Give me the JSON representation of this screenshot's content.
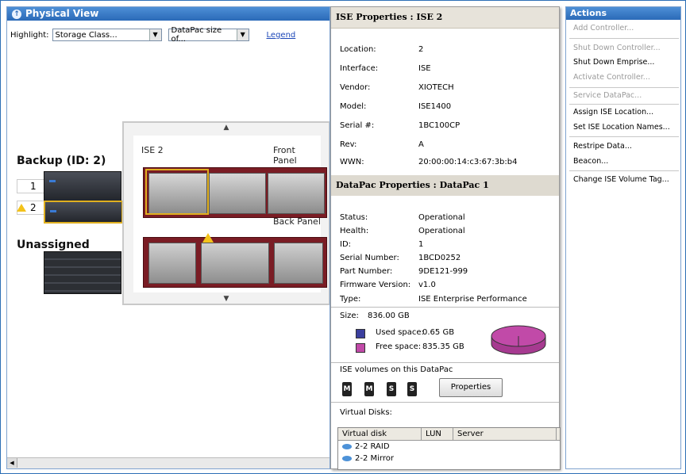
{
  "physical_view": {
    "title": "Physical View",
    "highlight_label": "Highlight:",
    "highlight_select": "Storage Class...",
    "datapac_select": "DataPac size of...",
    "legend_link": "Legend",
    "groups": [
      {
        "label": "Backup (ID: 2)",
        "slots": [
          "1",
          "2"
        ]
      },
      {
        "label": "Unassigned"
      }
    ],
    "popup": {
      "title": "ISE 2",
      "front_label": "Front Panel",
      "back_label": "Back Panel"
    }
  },
  "ise_props": {
    "title": "ISE Properties : ISE 2",
    "rows": [
      {
        "k": "Location:",
        "v": "2"
      },
      {
        "k": "Interface:",
        "v": "ISE"
      },
      {
        "k": "Vendor:",
        "v": "XIOTECH"
      },
      {
        "k": "Model:",
        "v": "ISE1400"
      },
      {
        "k": "Serial #:",
        "v": "1BC100CP"
      },
      {
        "k": "Rev:",
        "v": "A"
      },
      {
        "k": "WWN:",
        "v": "20:00:00:14:c3:67:3b:b4"
      }
    ]
  },
  "datapac_props": {
    "title": "DataPac Properties : DataPac 1",
    "rows": [
      {
        "k": "Status:",
        "v": "Operational"
      },
      {
        "k": "Health:",
        "v": "Operational"
      },
      {
        "k": "ID:",
        "v": "1"
      },
      {
        "k": "Serial Number:",
        "v": "1BCD0252"
      },
      {
        "k": "Part Number:",
        "v": "9DE121-999"
      },
      {
        "k": "Firmware Version:",
        "v": "v1.0"
      },
      {
        "k": "Type:",
        "v": "ISE Enterprise Performance"
      }
    ],
    "size_label": "Size:",
    "size_value": "836.00 GB",
    "used_label": "Used space:",
    "used_value": "0.65 GB",
    "free_label": "Free space:",
    "free_value": "835.35 GB",
    "used_color": "#3b3f9e",
    "free_color": "#c14aa8",
    "volumes_label": "ISE volumes on this DataPac",
    "volumes": [
      "M",
      "M",
      "S",
      "S"
    ],
    "properties_button": "Properties",
    "virtual_disks_label": "Virtual Disks:",
    "vd_columns": [
      "Virtual disk",
      "LUN",
      "Server"
    ],
    "vd_rows": [
      "2-2 RAID",
      "2-2 Mirror"
    ]
  },
  "actions": {
    "title": "Actions",
    "items": [
      {
        "label": "Add Controller...",
        "enabled": false
      },
      {
        "label": "Shut Down Controller...",
        "enabled": false
      },
      {
        "label": "Shut Down Emprise...",
        "enabled": true
      },
      {
        "label": "Activate Controller...",
        "enabled": false
      },
      {
        "label": "Service DataPac...",
        "enabled": false
      },
      {
        "label": "Assign ISE Location...",
        "enabled": true
      },
      {
        "label": "Set ISE Location Names...",
        "enabled": true
      },
      {
        "label": "Restripe Data...",
        "enabled": true
      },
      {
        "label": "Beacon...",
        "enabled": true
      },
      {
        "label": "Change ISE Volume Tag...",
        "enabled": true
      }
    ]
  }
}
